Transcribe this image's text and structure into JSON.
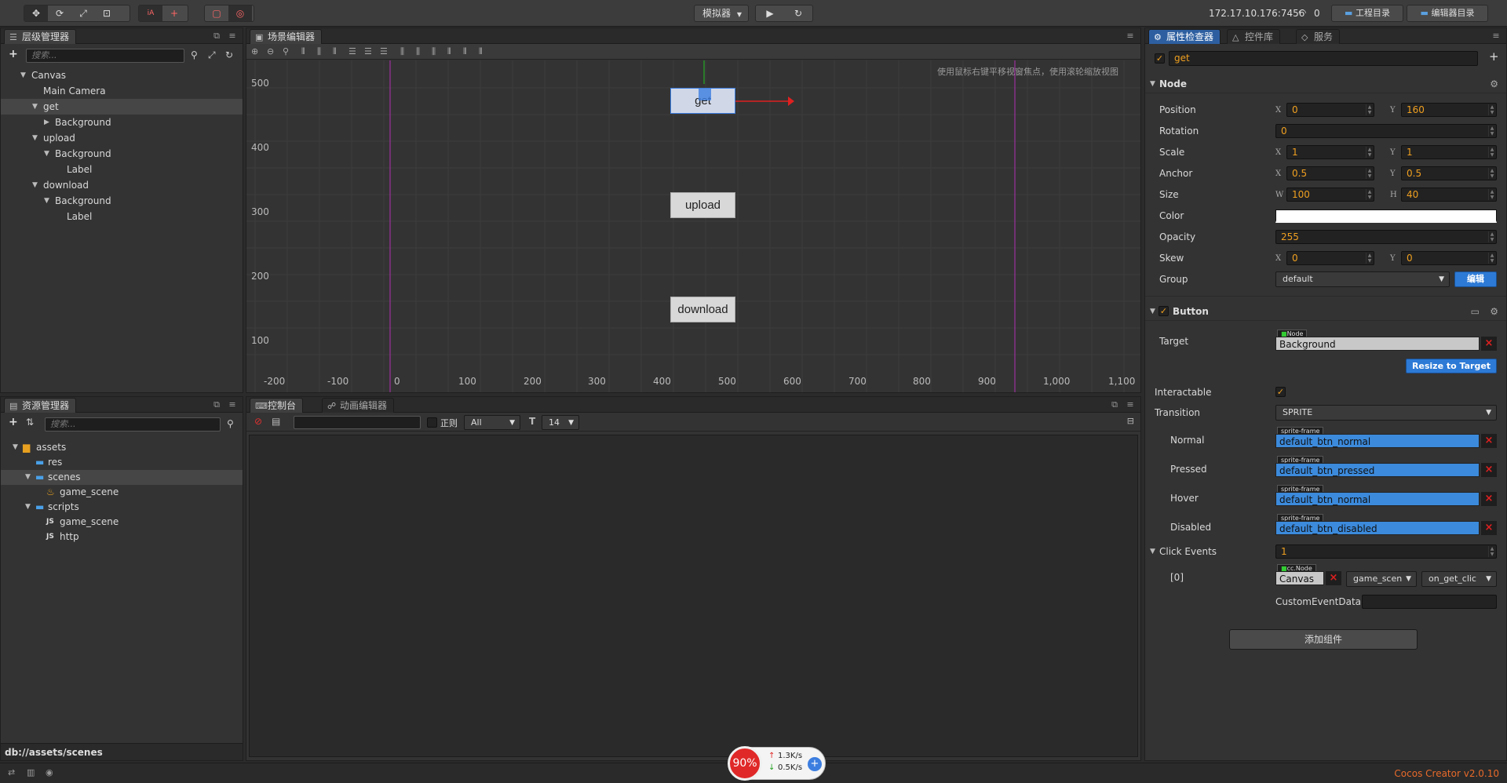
{
  "toolbar": {
    "simulator_label": "模拟器",
    "ip": "172.17.10.176:7456",
    "wifi_count": "0",
    "project_dir": "工程目录",
    "editor_dir": "编辑器目录"
  },
  "hierarchy": {
    "tab": "层级管理器",
    "search_placeholder": "搜索...",
    "nodes": [
      "Canvas",
      "Main Camera",
      "get",
      "Background",
      "upload",
      "Background",
      "Label",
      "download",
      "Background",
      "Label"
    ]
  },
  "scene": {
    "tab": "场景编辑器",
    "hint": "使用鼠标右键平移视窗焦点，使用滚轮缩放视图",
    "y_ticks": [
      "500",
      "400",
      "300",
      "200",
      "100"
    ],
    "x_ticks": [
      "-200",
      "-100",
      "0",
      "100",
      "200",
      "300",
      "400",
      "500",
      "600",
      "700",
      "800",
      "900",
      "1,000",
      "1,100"
    ],
    "buttons": [
      "get",
      "upload",
      "download"
    ]
  },
  "assets": {
    "tab": "资源管理器",
    "search_placeholder": "搜索...",
    "items": [
      "assets",
      "res",
      "scenes",
      "game_scene",
      "scripts",
      "game_scene",
      "http"
    ],
    "path": "db://assets/scenes"
  },
  "console": {
    "tab1": "控制台",
    "tab2": "动画编辑器",
    "regex_label": "正则",
    "filter": "All",
    "font_size": "14"
  },
  "inspector": {
    "tab1": "属性检查器",
    "tab2": "控件库",
    "tab3": "服务",
    "node_name": "get",
    "node_section": "Node",
    "position_label": "Position",
    "position_x": "0",
    "position_y": "160",
    "rotation_label": "Rotation",
    "rotation": "0",
    "scale_label": "Scale",
    "scale_x": "1",
    "scale_y": "1",
    "anchor_label": "Anchor",
    "anchor_x": "0.5",
    "anchor_y": "0.5",
    "size_label": "Size",
    "size_w": "100",
    "size_h": "40",
    "color_label": "Color",
    "color_value": "#ffffff",
    "opacity_label": "Opacity",
    "opacity": "255",
    "skew_label": "Skew",
    "skew_x": "0",
    "skew_y": "0",
    "group_label": "Group",
    "group": "default",
    "edit_label": "编辑",
    "button_section": "Button",
    "target_label": "Target",
    "target_tag": "Node",
    "target": "Background",
    "resize_label": "Resize to Target",
    "interactable_label": "Interactable",
    "transition_label": "Transition",
    "transition": "SPRITE",
    "sprite_tag": "sprite-frame",
    "normal_label": "Normal",
    "normal": "default_btn_normal",
    "pressed_label": "Pressed",
    "pressed": "default_btn_pressed",
    "hover_label": "Hover",
    "hover": "default_btn_normal",
    "disabled_label": "Disabled",
    "disabled": "default_btn_disabled",
    "click_events_label": "Click Events",
    "click_events": "1",
    "event_index": "[0]",
    "event_tag": "cc.Node",
    "event_target": "Canvas",
    "event_component": "game_scen",
    "event_handler": "on_get_clic",
    "custom_data_label": "CustomEventData",
    "add_component": "添加组件"
  },
  "status": {
    "percent": "90%",
    "up": "1.3K/s",
    "down": "0.5K/s",
    "version": "Cocos Creator v2.0.10"
  }
}
